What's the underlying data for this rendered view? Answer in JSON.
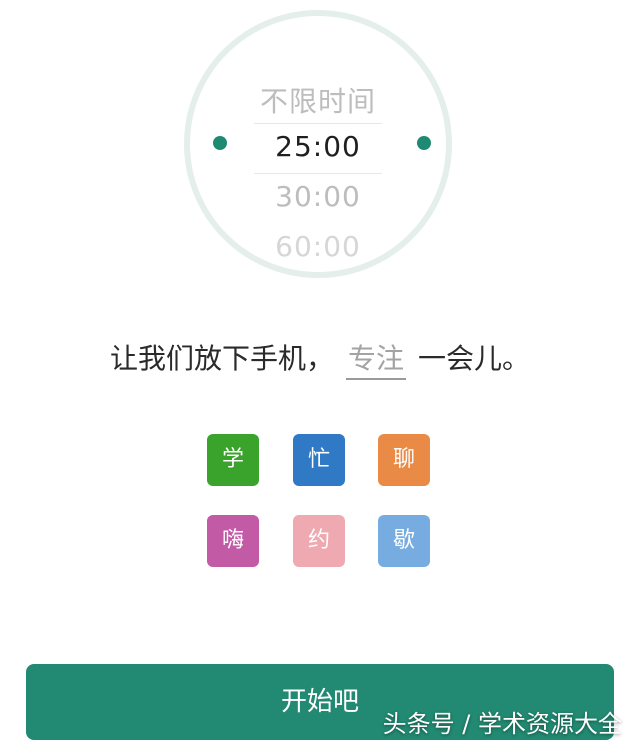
{
  "timer": {
    "options": [
      "不限时间",
      "25:00",
      "30:00",
      "60:00"
    ],
    "selected": "25:00"
  },
  "sentence": {
    "prefix": "让我们放下手机，",
    "focus_value": "专注",
    "suffix": "一会儿。"
  },
  "tags": [
    {
      "label": "学",
      "color": "#3aa32c"
    },
    {
      "label": "忙",
      "color": "#2f79c5"
    },
    {
      "label": "聊",
      "color": "#e98b47"
    },
    {
      "label": "嗨",
      "color": "#c35aa6"
    },
    {
      "label": "约",
      "color": "#eeaab0"
    },
    {
      "label": "歇",
      "color": "#76acdf"
    }
  ],
  "start_button": {
    "label": "开始吧",
    "color": "#228a72"
  },
  "watermark": {
    "text": "头条号 / 学术资源大全"
  }
}
